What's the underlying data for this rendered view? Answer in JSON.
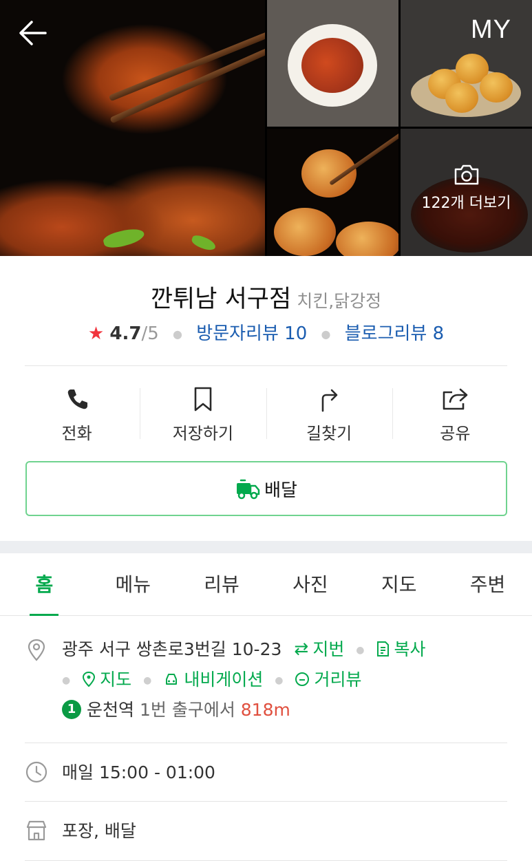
{
  "header": {
    "my_label": "MY",
    "more_photos_label": "122개 더보기"
  },
  "place": {
    "name": "깐튀남 서구점",
    "category": "치킨,닭강정",
    "rating": "4.7",
    "rating_max": "/5",
    "visitor_reviews": "방문자리뷰 10",
    "blog_reviews": "블로그리뷰 8"
  },
  "actions": [
    {
      "label": "전화",
      "icon": "phone-icon"
    },
    {
      "label": "저장하기",
      "icon": "bookmark-icon"
    },
    {
      "label": "길찾기",
      "icon": "directions-icon"
    },
    {
      "label": "공유",
      "icon": "share-icon"
    }
  ],
  "delivery_label": "배달",
  "tabs": [
    "홈",
    "메뉴",
    "리뷰",
    "사진",
    "지도",
    "주변"
  ],
  "active_tab": "홈",
  "address": {
    "text": "광주 서구 쌍촌로3번길 10-23",
    "jibun": "지번",
    "copy": "복사",
    "map": "지도",
    "navigation": "내비게이션",
    "streetview": "거리뷰",
    "subway_line": "1",
    "station": "운천역",
    "exit_text": "1번 출구에서",
    "distance": "818m"
  },
  "hours": "매일 15:00 - 01:00",
  "services": "포장, 배달",
  "colors": {
    "accent_green": "#03a94d",
    "link_blue": "#1b5db0",
    "star_red": "#f1343d",
    "distance_red": "#e0503f"
  }
}
